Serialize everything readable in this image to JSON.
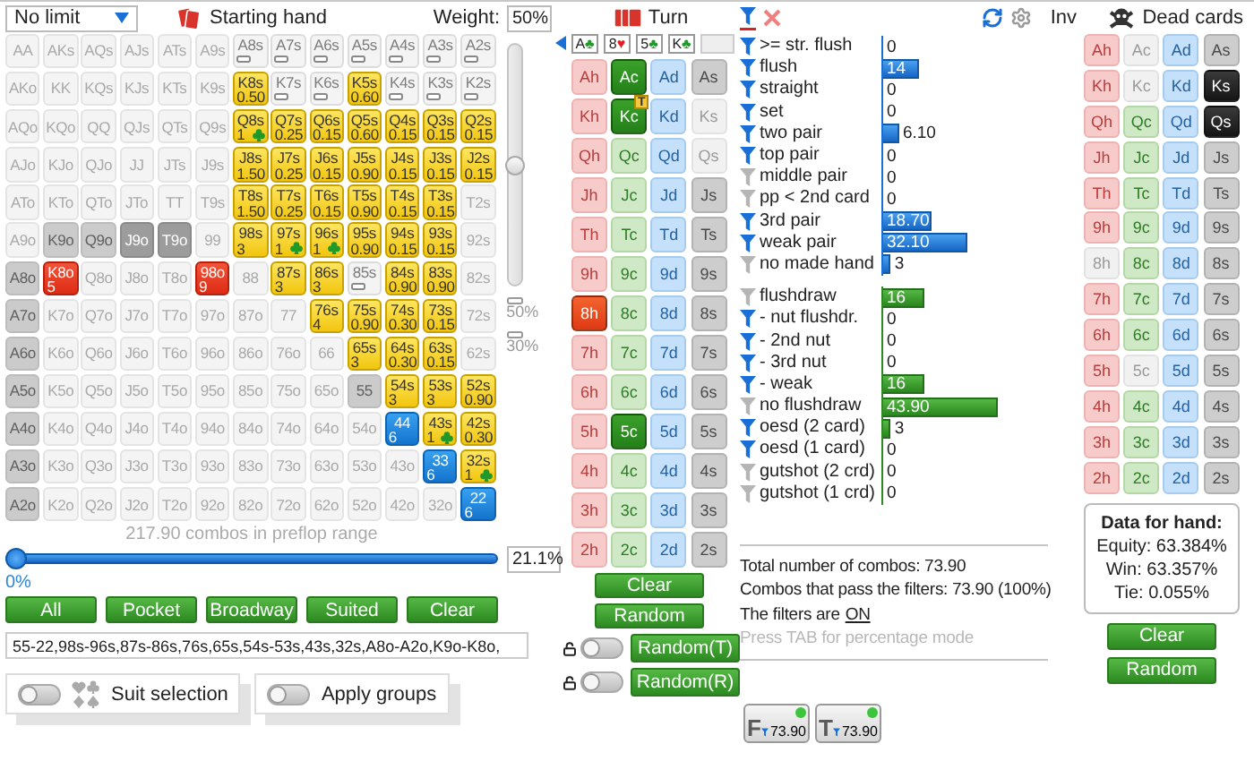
{
  "left": {
    "limit_dropdown": {
      "value": "No limit"
    },
    "starting_hand": "Starting hand",
    "weight_label": "Weight:",
    "weight_value": "50%",
    "weight_slider": {
      "level": 0.5
    },
    "weight_marks": [
      "50%",
      "30%"
    ],
    "grid": [
      [
        {
          "label": "AA",
          "kind": "dim"
        },
        {
          "label": "AKs",
          "kind": "dim"
        },
        {
          "label": "AQs",
          "kind": "dim"
        },
        {
          "label": "AJs",
          "kind": "dim"
        },
        {
          "label": "ATs",
          "kind": "dim"
        },
        {
          "label": "A9s",
          "kind": "dim"
        },
        {
          "label": "A8s",
          "kind": "marked"
        },
        {
          "label": "A7s",
          "kind": "marked"
        },
        {
          "label": "A6s",
          "kind": "marked"
        },
        {
          "label": "A5s",
          "kind": "marked"
        },
        {
          "label": "A4s",
          "kind": "marked"
        },
        {
          "label": "A3s",
          "kind": "marked"
        },
        {
          "label": "A2s",
          "kind": "marked"
        }
      ],
      [
        {
          "label": "AKo",
          "kind": "dim"
        },
        {
          "label": "KK",
          "kind": "dim"
        },
        {
          "label": "KQs",
          "kind": "dim"
        },
        {
          "label": "KJs",
          "kind": "dim"
        },
        {
          "label": "KTs",
          "kind": "dim"
        },
        {
          "label": "K9s",
          "kind": "dim"
        },
        {
          "label": "K8s",
          "kind": "yellow",
          "value": "0.50"
        },
        {
          "label": "K7s",
          "kind": "marked"
        },
        {
          "label": "K6s",
          "kind": "marked"
        },
        {
          "label": "K5s",
          "kind": "yellow",
          "value": "0.60"
        },
        {
          "label": "K4s",
          "kind": "marked"
        },
        {
          "label": "K3s",
          "kind": "marked"
        },
        {
          "label": "K2s",
          "kind": "marked"
        }
      ],
      [
        {
          "label": "AQo",
          "kind": "dim"
        },
        {
          "label": "KQo",
          "kind": "dim"
        },
        {
          "label": "QQ",
          "kind": "dim"
        },
        {
          "label": "QJs",
          "kind": "dim"
        },
        {
          "label": "QTs",
          "kind": "dim"
        },
        {
          "label": "Q9s",
          "kind": "dim"
        },
        {
          "label": "Q8s",
          "kind": "yellow_club",
          "value": "1"
        },
        {
          "label": "Q7s",
          "kind": "yellow",
          "value": "0.25"
        },
        {
          "label": "Q6s",
          "kind": "yellow",
          "value": "0.15"
        },
        {
          "label": "Q5s",
          "kind": "yellow",
          "value": "0.60"
        },
        {
          "label": "Q4s",
          "kind": "yellow",
          "value": "0.15"
        },
        {
          "label": "Q3s",
          "kind": "yellow",
          "value": "0.15"
        },
        {
          "label": "Q2s",
          "kind": "yellow",
          "value": "0.15"
        }
      ],
      [
        {
          "label": "AJo",
          "kind": "dim"
        },
        {
          "label": "KJo",
          "kind": "dim"
        },
        {
          "label": "QJo",
          "kind": "dim"
        },
        {
          "label": "JJ",
          "kind": "dim"
        },
        {
          "label": "JTs",
          "kind": "dim"
        },
        {
          "label": "J9s",
          "kind": "dim"
        },
        {
          "label": "J8s",
          "kind": "yellow",
          "value": "1.50"
        },
        {
          "label": "J7s",
          "kind": "yellow",
          "value": "0.25"
        },
        {
          "label": "J6s",
          "kind": "yellow",
          "value": "0.15"
        },
        {
          "label": "J5s",
          "kind": "yellow",
          "value": "0.90"
        },
        {
          "label": "J4s",
          "kind": "yellow",
          "value": "0.15"
        },
        {
          "label": "J3s",
          "kind": "yellow",
          "value": "0.15"
        },
        {
          "label": "J2s",
          "kind": "yellow",
          "value": "0.15"
        }
      ],
      [
        {
          "label": "ATo",
          "kind": "dim"
        },
        {
          "label": "KTo",
          "kind": "dim"
        },
        {
          "label": "QTo",
          "kind": "dim"
        },
        {
          "label": "JTo",
          "kind": "dim"
        },
        {
          "label": "TT",
          "kind": "dim"
        },
        {
          "label": "T9s",
          "kind": "dim"
        },
        {
          "label": "T8s",
          "kind": "yellow",
          "value": "1.50"
        },
        {
          "label": "T7s",
          "kind": "yellow",
          "value": "0.25"
        },
        {
          "label": "T6s",
          "kind": "yellow",
          "value": "0.15"
        },
        {
          "label": "T5s",
          "kind": "yellow",
          "value": "0.90"
        },
        {
          "label": "T4s",
          "kind": "yellow",
          "value": "0.15"
        },
        {
          "label": "T3s",
          "kind": "yellow",
          "value": "0.15"
        },
        {
          "label": "T2s",
          "kind": "dim"
        }
      ],
      [
        {
          "label": "A9o",
          "kind": "dim"
        },
        {
          "label": "K9o",
          "kind": "grey"
        },
        {
          "label": "Q9o",
          "kind": "grey"
        },
        {
          "label": "J9o",
          "kind": "dark"
        },
        {
          "label": "T9o",
          "kind": "dark"
        },
        {
          "label": "99",
          "kind": "dim"
        },
        {
          "label": "98s",
          "kind": "yellow",
          "value": "3"
        },
        {
          "label": "97s",
          "kind": "yellow_club",
          "value": "1"
        },
        {
          "label": "96s",
          "kind": "yellow_club",
          "value": "1"
        },
        {
          "label": "95s",
          "kind": "yellow",
          "value": "0.90"
        },
        {
          "label": "94s",
          "kind": "yellow",
          "value": "0.15"
        },
        {
          "label": "93s",
          "kind": "yellow",
          "value": "0.15"
        },
        {
          "label": "92s",
          "kind": "dim"
        }
      ],
      [
        {
          "label": "A8o",
          "kind": "grey"
        },
        {
          "label": "K8o",
          "kind": "red",
          "value": "5"
        },
        {
          "label": "Q8o",
          "kind": "dim"
        },
        {
          "label": "J8o",
          "kind": "dim"
        },
        {
          "label": "T8o",
          "kind": "dim"
        },
        {
          "label": "98o",
          "kind": "red",
          "value": "9"
        },
        {
          "label": "88",
          "kind": "dim"
        },
        {
          "label": "87s",
          "kind": "yellow",
          "value": "3"
        },
        {
          "label": "86s",
          "kind": "yellow",
          "value": "3"
        },
        {
          "label": "85s",
          "kind": "marked"
        },
        {
          "label": "84s",
          "kind": "yellow",
          "value": "0.90"
        },
        {
          "label": "83s",
          "kind": "yellow",
          "value": "0.90"
        },
        {
          "label": "82s",
          "kind": "dim"
        }
      ],
      [
        {
          "label": "A7o",
          "kind": "grey"
        },
        {
          "label": "K7o",
          "kind": "dim"
        },
        {
          "label": "Q7o",
          "kind": "dim"
        },
        {
          "label": "J7o",
          "kind": "dim"
        },
        {
          "label": "T7o",
          "kind": "dim"
        },
        {
          "label": "97o",
          "kind": "dim"
        },
        {
          "label": "87o",
          "kind": "dim"
        },
        {
          "label": "77",
          "kind": "dim"
        },
        {
          "label": "76s",
          "kind": "yellow",
          "value": "4"
        },
        {
          "label": "75s",
          "kind": "yellow",
          "value": "0.90"
        },
        {
          "label": "74s",
          "kind": "yellow",
          "value": "0.30"
        },
        {
          "label": "73s",
          "kind": "yellow",
          "value": "0.15"
        },
        {
          "label": "72s",
          "kind": "dim"
        }
      ],
      [
        {
          "label": "A6o",
          "kind": "grey"
        },
        {
          "label": "K6o",
          "kind": "dim"
        },
        {
          "label": "Q6o",
          "kind": "dim"
        },
        {
          "label": "J6o",
          "kind": "dim"
        },
        {
          "label": "T6o",
          "kind": "dim"
        },
        {
          "label": "96o",
          "kind": "dim"
        },
        {
          "label": "86o",
          "kind": "dim"
        },
        {
          "label": "76o",
          "kind": "dim"
        },
        {
          "label": "66",
          "kind": "dim"
        },
        {
          "label": "65s",
          "kind": "yellow",
          "value": "3"
        },
        {
          "label": "64s",
          "kind": "yellow",
          "value": "0.30"
        },
        {
          "label": "63s",
          "kind": "yellow",
          "value": "0.15"
        },
        {
          "label": "62s",
          "kind": "dim"
        }
      ],
      [
        {
          "label": "A5o",
          "kind": "grey"
        },
        {
          "label": "K5o",
          "kind": "dim"
        },
        {
          "label": "Q5o",
          "kind": "dim"
        },
        {
          "label": "J5o",
          "kind": "dim"
        },
        {
          "label": "T5o",
          "kind": "dim"
        },
        {
          "label": "95o",
          "kind": "dim"
        },
        {
          "label": "85o",
          "kind": "dim"
        },
        {
          "label": "75o",
          "kind": "dim"
        },
        {
          "label": "65o",
          "kind": "dim"
        },
        {
          "label": "55",
          "kind": "grey"
        },
        {
          "label": "54s",
          "kind": "yellow",
          "value": "3"
        },
        {
          "label": "53s",
          "kind": "yellow",
          "value": "3"
        },
        {
          "label": "52s",
          "kind": "yellow",
          "value": "0.90"
        }
      ],
      [
        {
          "label": "A4o",
          "kind": "grey"
        },
        {
          "label": "K4o",
          "kind": "dim"
        },
        {
          "label": "Q4o",
          "kind": "dim"
        },
        {
          "label": "J4o",
          "kind": "dim"
        },
        {
          "label": "T4o",
          "kind": "dim"
        },
        {
          "label": "94o",
          "kind": "dim"
        },
        {
          "label": "84o",
          "kind": "dim"
        },
        {
          "label": "74o",
          "kind": "dim"
        },
        {
          "label": "64o",
          "kind": "dim"
        },
        {
          "label": "54o",
          "kind": "dim"
        },
        {
          "label": "44",
          "kind": "blue",
          "value": "6"
        },
        {
          "label": "43s",
          "kind": "yellow_club",
          "value": "1"
        },
        {
          "label": "42s",
          "kind": "yellow",
          "value": "0.30"
        }
      ],
      [
        {
          "label": "A3o",
          "kind": "grey"
        },
        {
          "label": "K3o",
          "kind": "dim"
        },
        {
          "label": "Q3o",
          "kind": "dim"
        },
        {
          "label": "J3o",
          "kind": "dim"
        },
        {
          "label": "T3o",
          "kind": "dim"
        },
        {
          "label": "93o",
          "kind": "dim"
        },
        {
          "label": "83o",
          "kind": "dim"
        },
        {
          "label": "73o",
          "kind": "dim"
        },
        {
          "label": "63o",
          "kind": "dim"
        },
        {
          "label": "53o",
          "kind": "dim"
        },
        {
          "label": "43o",
          "kind": "dim"
        },
        {
          "label": "33",
          "kind": "blue",
          "value": "6"
        },
        {
          "label": "32s",
          "kind": "yellow_club",
          "value": "1"
        }
      ],
      [
        {
          "label": "A2o",
          "kind": "grey"
        },
        {
          "label": "K2o",
          "kind": "dim"
        },
        {
          "label": "Q2o",
          "kind": "dim"
        },
        {
          "label": "J2o",
          "kind": "dim"
        },
        {
          "label": "T2o",
          "kind": "dim"
        },
        {
          "label": "92o",
          "kind": "dim"
        },
        {
          "label": "82o",
          "kind": "dim"
        },
        {
          "label": "72o",
          "kind": "dim"
        },
        {
          "label": "62o",
          "kind": "dim"
        },
        {
          "label": "52o",
          "kind": "dim"
        },
        {
          "label": "42o",
          "kind": "dim"
        },
        {
          "label": "32o",
          "kind": "dim"
        },
        {
          "label": "22",
          "kind": "blue",
          "value": "6"
        }
      ]
    ],
    "combos_text": "217.90 combos in preflop range",
    "range_slider": {
      "level": 0
    },
    "range_percent": "21.1%",
    "range_min": "0%",
    "buttons": [
      "All",
      "Pocket",
      "Broadway",
      "Suited",
      "Clear"
    ],
    "range_text": "55-22,98s-96s,87s-86s,76s,65s,54s-53s,43s,32s,A8o-A2o,K9o-K8o,",
    "toggles": [
      {
        "label": "Suit selection",
        "on": false,
        "kind": "suits"
      },
      {
        "label": "Apply groups",
        "on": false,
        "kind": "plain"
      }
    ]
  },
  "board": {
    "title": "Turn",
    "cards": [
      {
        "rank": "A",
        "symbol": "♣",
        "kind": "c"
      },
      {
        "rank": "8",
        "symbol": "♥",
        "kind": "h"
      },
      {
        "rank": "5",
        "symbol": "♣",
        "kind": "c"
      },
      {
        "rank": "K",
        "symbol": "♣",
        "kind": "c"
      }
    ],
    "grid": [
      [
        {
          "label": "Ah",
          "kind": "h",
          "selected": false,
          "disabled": false
        },
        {
          "label": "Ac",
          "kind": "c",
          "selected": true,
          "disabled": false
        },
        {
          "label": "Ad",
          "kind": "d",
          "selected": false,
          "disabled": false
        },
        {
          "label": "As",
          "kind": "s",
          "selected": false,
          "disabled": false
        }
      ],
      [
        {
          "label": "Kh",
          "kind": "h",
          "selected": false,
          "disabled": false
        },
        {
          "label": "Kc",
          "kind": "c",
          "selected": true,
          "disabled": false,
          "badge": "T"
        },
        {
          "label": "Kd",
          "kind": "d",
          "selected": false,
          "disabled": false
        },
        {
          "label": "Ks",
          "kind": "s",
          "selected": false,
          "disabled": true
        }
      ],
      [
        {
          "label": "Qh",
          "kind": "h",
          "selected": false,
          "disabled": false
        },
        {
          "label": "Qc",
          "kind": "c",
          "selected": false,
          "disabled": false
        },
        {
          "label": "Qd",
          "kind": "d",
          "selected": false,
          "disabled": false
        },
        {
          "label": "Qs",
          "kind": "s",
          "selected": false,
          "disabled": true
        }
      ],
      [
        {
          "label": "Jh",
          "kind": "h",
          "selected": false,
          "disabled": false
        },
        {
          "label": "Jc",
          "kind": "c",
          "selected": false,
          "disabled": false
        },
        {
          "label": "Jd",
          "kind": "d",
          "selected": false,
          "disabled": false
        },
        {
          "label": "Js",
          "kind": "s",
          "selected": false,
          "disabled": false
        }
      ],
      [
        {
          "label": "Th",
          "kind": "h",
          "selected": false,
          "disabled": false
        },
        {
          "label": "Tc",
          "kind": "c",
          "selected": false,
          "disabled": false
        },
        {
          "label": "Td",
          "kind": "d",
          "selected": false,
          "disabled": false
        },
        {
          "label": "Ts",
          "kind": "s",
          "selected": false,
          "disabled": false
        }
      ],
      [
        {
          "label": "9h",
          "kind": "h",
          "selected": false,
          "disabled": false
        },
        {
          "label": "9c",
          "kind": "c",
          "selected": false,
          "disabled": false
        },
        {
          "label": "9d",
          "kind": "d",
          "selected": false,
          "disabled": false
        },
        {
          "label": "9s",
          "kind": "s",
          "selected": false,
          "disabled": false
        }
      ],
      [
        {
          "label": "8h",
          "kind": "h",
          "selected": true,
          "disabled": false
        },
        {
          "label": "8c",
          "kind": "c",
          "selected": false,
          "disabled": false
        },
        {
          "label": "8d",
          "kind": "d",
          "selected": false,
          "disabled": false
        },
        {
          "label": "8s",
          "kind": "s",
          "selected": false,
          "disabled": false
        }
      ],
      [
        {
          "label": "7h",
          "kind": "h",
          "selected": false,
          "disabled": false
        },
        {
          "label": "7c",
          "kind": "c",
          "selected": false,
          "disabled": false
        },
        {
          "label": "7d",
          "kind": "d",
          "selected": false,
          "disabled": false
        },
        {
          "label": "7s",
          "kind": "s",
          "selected": false,
          "disabled": false
        }
      ],
      [
        {
          "label": "6h",
          "kind": "h",
          "selected": false,
          "disabled": false
        },
        {
          "label": "6c",
          "kind": "c",
          "selected": false,
          "disabled": false
        },
        {
          "label": "6d",
          "kind": "d",
          "selected": false,
          "disabled": false
        },
        {
          "label": "6s",
          "kind": "s",
          "selected": false,
          "disabled": false
        }
      ],
      [
        {
          "label": "5h",
          "kind": "h",
          "selected": false,
          "disabled": false
        },
        {
          "label": "5c",
          "kind": "c",
          "selected": true,
          "disabled": false
        },
        {
          "label": "5d",
          "kind": "d",
          "selected": false,
          "disabled": false
        },
        {
          "label": "5s",
          "kind": "s",
          "selected": false,
          "disabled": false
        }
      ],
      [
        {
          "label": "4h",
          "kind": "h",
          "selected": false,
          "disabled": false
        },
        {
          "label": "4c",
          "kind": "c",
          "selected": false,
          "disabled": false
        },
        {
          "label": "4d",
          "kind": "d",
          "selected": false,
          "disabled": false
        },
        {
          "label": "4s",
          "kind": "s",
          "selected": false,
          "disabled": false
        }
      ],
      [
        {
          "label": "3h",
          "kind": "h",
          "selected": false,
          "disabled": false
        },
        {
          "label": "3c",
          "kind": "c",
          "selected": false,
          "disabled": false
        },
        {
          "label": "3d",
          "kind": "d",
          "selected": false,
          "disabled": false
        },
        {
          "label": "3s",
          "kind": "s",
          "selected": false,
          "disabled": false
        }
      ],
      [
        {
          "label": "2h",
          "kind": "h",
          "selected": false,
          "disabled": false
        },
        {
          "label": "2c",
          "kind": "c",
          "selected": false,
          "disabled": false
        },
        {
          "label": "2d",
          "kind": "d",
          "selected": false,
          "disabled": false
        },
        {
          "label": "2s",
          "kind": "s",
          "selected": false,
          "disabled": false
        }
      ]
    ],
    "buttons": [
      {
        "label": "Clear",
        "kind": "plain"
      },
      {
        "label": "Random",
        "kind": "plain"
      },
      {
        "label": "Random(T)",
        "kind": "lock",
        "on": false
      },
      {
        "label": "Random(R)",
        "kind": "lock",
        "on": false
      }
    ]
  },
  "filters": {
    "inventory_label": "Inv",
    "groups": [
      {
        "kind": "made",
        "rows": [
          {
            "label": ">= str. flush",
            "active": true,
            "value": "0"
          },
          {
            "label": "flush",
            "active": true,
            "value": "14",
            "level": 0.189
          },
          {
            "label": "straight",
            "active": true,
            "value": "0"
          },
          {
            "label": "set",
            "active": true,
            "value": "0"
          },
          {
            "label": "two pair",
            "active": true,
            "value": "6.10",
            "level": 0.083
          },
          {
            "label": "top pair",
            "active": true,
            "value": "0"
          },
          {
            "label": "middle pair",
            "active": false,
            "value": "0"
          },
          {
            "label": "pp < 2nd card",
            "active": false,
            "value": "0"
          },
          {
            "label": "3rd pair",
            "active": true,
            "value": "18.70",
            "level": 0.253
          },
          {
            "label": "weak pair",
            "active": true,
            "value": "32.10",
            "level": 0.434
          },
          {
            "label": "no made hand",
            "active": false,
            "value": "3",
            "level": 0.041
          }
        ]
      },
      {
        "kind": "draw",
        "rows": [
          {
            "label": "flushdraw",
            "active": false,
            "value": "16",
            "level": 0.217
          },
          {
            "label": "- nut flushdr.",
            "active": true,
            "value": "0"
          },
          {
            "label": "- 2nd nut",
            "active": true,
            "value": "0"
          },
          {
            "label": "- 3rd nut",
            "active": true,
            "value": "0"
          },
          {
            "label": "- weak",
            "active": true,
            "value": "16",
            "level": 0.217
          },
          {
            "label": "no flushdraw",
            "active": false,
            "value": "43.90",
            "level": 0.594
          },
          {
            "label": "oesd (2 card)",
            "active": true,
            "value": "3",
            "level": 0.041
          },
          {
            "label": "oesd (1 card)",
            "active": true,
            "value": "0"
          },
          {
            "label": "gutshot (2 crd)",
            "active": false,
            "value": "0"
          },
          {
            "label": "gutshot (1 crd)",
            "active": false,
            "value": "0"
          }
        ]
      }
    ],
    "summary": [
      "Total number of combos: 73.90",
      "Combos that pass the filters: 73.90 (100%)"
    ],
    "filters_state_label": "The filters are",
    "filters_state": "ON",
    "hint": "Press TAB for percentage mode",
    "badges": [
      {
        "letter": "F",
        "value": "73.90",
        "on": true
      },
      {
        "letter": "T",
        "value": "73.90",
        "on": true
      }
    ]
  },
  "dead_cards": {
    "title": "Dead cards",
    "grid": [
      [
        {
          "label": "Ah",
          "kind": "h",
          "selected": false,
          "disabled": false
        },
        {
          "label": "Ac",
          "kind": "c",
          "selected": false,
          "disabled": true
        },
        {
          "label": "Ad",
          "kind": "d",
          "selected": false,
          "disabled": false
        },
        {
          "label": "As",
          "kind": "s",
          "selected": false,
          "disabled": false
        }
      ],
      [
        {
          "label": "Kh",
          "kind": "h",
          "selected": false,
          "disabled": false
        },
        {
          "label": "Kc",
          "kind": "c",
          "selected": false,
          "disabled": true
        },
        {
          "label": "Kd",
          "kind": "d",
          "selected": false,
          "disabled": false
        },
        {
          "label": "Ks",
          "kind": "s",
          "selected": true,
          "disabled": false
        }
      ],
      [
        {
          "label": "Qh",
          "kind": "h",
          "selected": false,
          "disabled": false
        },
        {
          "label": "Qc",
          "kind": "c",
          "selected": false,
          "disabled": false
        },
        {
          "label": "Qd",
          "kind": "d",
          "selected": false,
          "disabled": false
        },
        {
          "label": "Qs",
          "kind": "s",
          "selected": true,
          "disabled": false
        }
      ],
      [
        {
          "label": "Jh",
          "kind": "h",
          "selected": false,
          "disabled": false
        },
        {
          "label": "Jc",
          "kind": "c",
          "selected": false,
          "disabled": false
        },
        {
          "label": "Jd",
          "kind": "d",
          "selected": false,
          "disabled": false
        },
        {
          "label": "Js",
          "kind": "s",
          "selected": false,
          "disabled": false
        }
      ],
      [
        {
          "label": "Th",
          "kind": "h",
          "selected": false,
          "disabled": false
        },
        {
          "label": "Tc",
          "kind": "c",
          "selected": false,
          "disabled": false
        },
        {
          "label": "Td",
          "kind": "d",
          "selected": false,
          "disabled": false
        },
        {
          "label": "Ts",
          "kind": "s",
          "selected": false,
          "disabled": false
        }
      ],
      [
        {
          "label": "9h",
          "kind": "h",
          "selected": false,
          "disabled": false
        },
        {
          "label": "9c",
          "kind": "c",
          "selected": false,
          "disabled": false
        },
        {
          "label": "9d",
          "kind": "d",
          "selected": false,
          "disabled": false
        },
        {
          "label": "9s",
          "kind": "s",
          "selected": false,
          "disabled": false
        }
      ],
      [
        {
          "label": "8h",
          "kind": "h",
          "selected": false,
          "disabled": true
        },
        {
          "label": "8c",
          "kind": "c",
          "selected": false,
          "disabled": false
        },
        {
          "label": "8d",
          "kind": "d",
          "selected": false,
          "disabled": false
        },
        {
          "label": "8s",
          "kind": "s",
          "selected": false,
          "disabled": false
        }
      ],
      [
        {
          "label": "7h",
          "kind": "h",
          "selected": false,
          "disabled": false
        },
        {
          "label": "7c",
          "kind": "c",
          "selected": false,
          "disabled": false
        },
        {
          "label": "7d",
          "kind": "d",
          "selected": false,
          "disabled": false
        },
        {
          "label": "7s",
          "kind": "s",
          "selected": false,
          "disabled": false
        }
      ],
      [
        {
          "label": "6h",
          "kind": "h",
          "selected": false,
          "disabled": false
        },
        {
          "label": "6c",
          "kind": "c",
          "selected": false,
          "disabled": false
        },
        {
          "label": "6d",
          "kind": "d",
          "selected": false,
          "disabled": false
        },
        {
          "label": "6s",
          "kind": "s",
          "selected": false,
          "disabled": false
        }
      ],
      [
        {
          "label": "5h",
          "kind": "h",
          "selected": false,
          "disabled": false
        },
        {
          "label": "5c",
          "kind": "c",
          "selected": false,
          "disabled": true
        },
        {
          "label": "5d",
          "kind": "d",
          "selected": false,
          "disabled": false
        },
        {
          "label": "5s",
          "kind": "s",
          "selected": false,
          "disabled": false
        }
      ],
      [
        {
          "label": "4h",
          "kind": "h",
          "selected": false,
          "disabled": false
        },
        {
          "label": "4c",
          "kind": "c",
          "selected": false,
          "disabled": false
        },
        {
          "label": "4d",
          "kind": "d",
          "selected": false,
          "disabled": false
        },
        {
          "label": "4s",
          "kind": "s",
          "selected": false,
          "disabled": false
        }
      ],
      [
        {
          "label": "3h",
          "kind": "h",
          "selected": false,
          "disabled": false
        },
        {
          "label": "3c",
          "kind": "c",
          "selected": false,
          "disabled": false
        },
        {
          "label": "3d",
          "kind": "d",
          "selected": false,
          "disabled": false
        },
        {
          "label": "3s",
          "kind": "s",
          "selected": false,
          "disabled": false
        }
      ],
      [
        {
          "label": "2h",
          "kind": "h",
          "selected": false,
          "disabled": false
        },
        {
          "label": "2c",
          "kind": "c",
          "selected": false,
          "disabled": false
        },
        {
          "label": "2d",
          "kind": "d",
          "selected": false,
          "disabled": false
        },
        {
          "label": "2s",
          "kind": "s",
          "selected": false,
          "disabled": false
        }
      ]
    ],
    "hand_data": {
      "title": "Data for hand:",
      "lines": [
        "Equity: 63.384%",
        "Win: 63.357%",
        "Tie: 0.055%"
      ]
    },
    "buttons": [
      "Clear",
      "Random"
    ]
  }
}
